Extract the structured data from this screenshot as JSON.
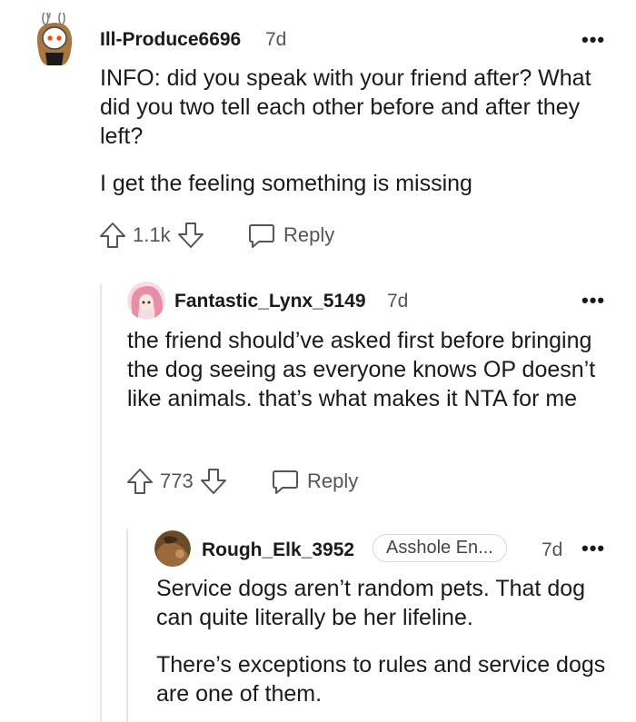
{
  "comments": [
    {
      "username": "Ill-Produce6696",
      "time": "7d",
      "paragraphs": [
        "INFO: did you speak with your friend after? What did you two tell each other before and after they left?",
        "I get the feeling something is missing"
      ],
      "votes": "1.1k",
      "reply_label": "Reply",
      "avatar_icon": "snoo-bunny-avatar"
    },
    {
      "username": "Fantastic_Lynx_5149",
      "time": "7d",
      "paragraphs": [
        "the friend should’ve asked first before bringing the dog seeing as everyone knows OP doesn’t like animals. that’s what makes it NTA for me"
      ],
      "votes": "773",
      "reply_label": "Reply",
      "avatar_icon": "pink-hair-avatar"
    },
    {
      "username": "Rough_Elk_3952",
      "flair": "Asshole En...",
      "time": "7d",
      "paragraphs": [
        "Service dogs aren’t random pets. That dog can quite literally be her lifeline.",
        "There’s exceptions to rules and service dogs are one of them."
      ],
      "avatar_icon": "brown-photo-avatar"
    }
  ],
  "colors": {
    "text": "#1a1a1b",
    "meta": "#555555",
    "thread_line": "#e6e6e6"
  }
}
